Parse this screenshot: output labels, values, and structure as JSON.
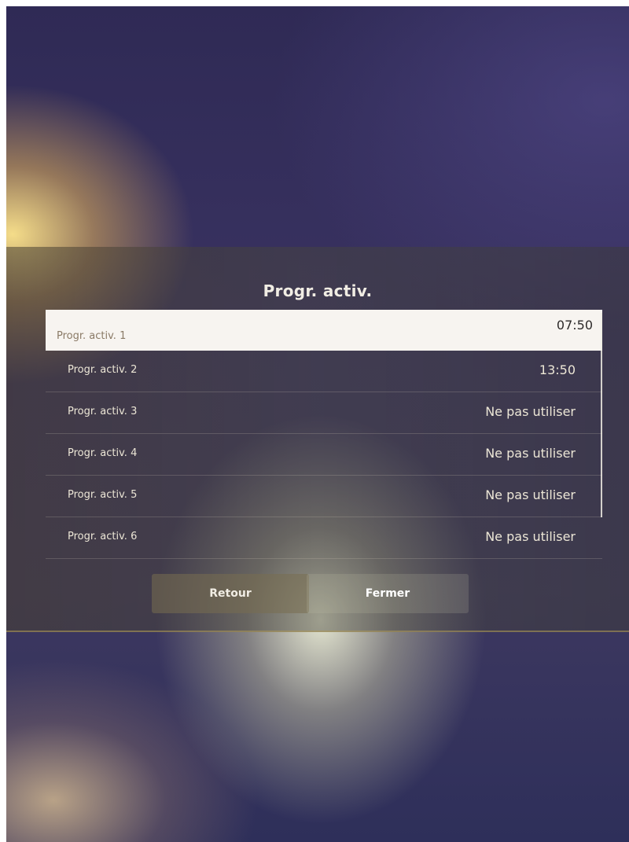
{
  "dialog": {
    "title": "Progr. activ.",
    "items": [
      {
        "label": "Progr. activ. 1",
        "value": "07:50",
        "selected": true
      },
      {
        "label": "Progr. activ. 2",
        "value": "13:50",
        "selected": false
      },
      {
        "label": "Progr. activ. 3",
        "value": "Ne pas utiliser",
        "selected": false
      },
      {
        "label": "Progr. activ. 4",
        "value": "Ne pas utiliser",
        "selected": false
      },
      {
        "label": "Progr. activ. 5",
        "value": "Ne pas utiliser",
        "selected": false
      },
      {
        "label": "Progr. activ. 6",
        "value": "Ne pas utiliser",
        "selected": false
      }
    ],
    "buttons": {
      "back_label": "Retour",
      "close_label": "Fermer"
    }
  },
  "colors": {
    "background": "#3a3362",
    "selected_row": "#f7f4f0",
    "text": "#ece6d6"
  }
}
